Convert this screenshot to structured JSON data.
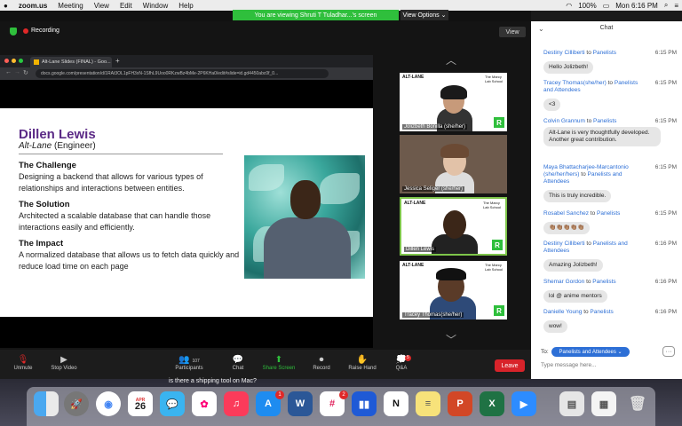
{
  "menubar": {
    "app": "zoom.us",
    "items": [
      "Meeting",
      "View",
      "Edit",
      "Window",
      "Help"
    ],
    "battery": "100%",
    "clock": "Mon 6:16 PM"
  },
  "banner": {
    "viewing": "You are viewing Shruti T Tuladhar...'s screen",
    "view_options": "View Options ⌄"
  },
  "recording": "Recording",
  "view_button": "View",
  "browser": {
    "tab": "Alt-Lane Slides (FINAL) - Goo...",
    "url": "docs.google.com/presentation/d/1RAt3OL1pFH3xN-1SfhL9Uoo0RKzwBz4bMe-2P6KHa0/edit#slide=id.gd4450abc0f_0..."
  },
  "slide": {
    "name": "Dillen Lewis",
    "company": "Alt-Lane",
    "role": "(Engineer)",
    "h1": "The Challenge",
    "b1": "Designing a backend that allows for various types of relationships and interactions between entities.",
    "h2": "The Solution",
    "b2": "Architected a scalable database that can handle those interactions easily and efficiently.",
    "h3": "The Impact",
    "b3": "A normalized database that allows us to fetch data quickly and reduce load time on each page"
  },
  "tiles": [
    {
      "name": "Jolizbeth Bonilla (she/her)",
      "logo": "ALT-LANE",
      "school": "The Marcy Lab School"
    },
    {
      "name": "Jessica Seliger (she/her)"
    },
    {
      "name": "Dillen Lewis",
      "logo": "ALT-LANE",
      "school": "The Marcy Lab School"
    },
    {
      "name": "Tracey Thomas(she/her)",
      "logo": "ALT-LANE",
      "school": "The Marcy Lab School"
    }
  ],
  "toolbar": {
    "unmute": "Unmute",
    "stop_video": "Stop Video",
    "participants": "Participants",
    "participants_count": "107",
    "chat": "Chat",
    "share": "Share Screen",
    "record": "Record",
    "raise": "Raise Hand",
    "qa": "Q&A",
    "qa_count": "5",
    "leave": "Leave"
  },
  "chat": {
    "title": "Chat",
    "messages": [
      {
        "from": "Destiny Cilliberti",
        "to": "Panelists",
        "time": "6:15 PM",
        "text": "Hello Jolizbeth!"
      },
      {
        "from": "Tracey Thomas(she/her)",
        "to": "Panelists and Attendees",
        "time": "6:15 PM",
        "text": "<3"
      },
      {
        "from": "Colvin Grannum",
        "to": "Panelists",
        "time": "6:15 PM",
        "text": "Alt-Lane is very thoughtfully developed. Another great contribution."
      },
      {
        "from": "Maya Bhattacharjee-Marcantonio (she/her/hers)",
        "to": "Panelists and Attendees",
        "time": "6:15 PM",
        "text": "This is truly incredible."
      },
      {
        "from": "Rosabel Sanchez",
        "to": "Panelists",
        "time": "6:15 PM",
        "text": "👏🏽👏🏽👏🏽👏🏽👏🏽"
      },
      {
        "from": "Destiny Cilliberti",
        "to": "Panelists and Attendees",
        "time": "6:16 PM",
        "text": "Amazing Jolizbeth!"
      },
      {
        "from": "Shemar Gordon",
        "to": "Panelists",
        "time": "6:16 PM",
        "text": "lol @ anime mentors"
      },
      {
        "from": "Danielle Young",
        "to": "Panelists",
        "time": "6:16 PM",
        "text": "wow!"
      }
    ],
    "to_label": "To:",
    "to_value": "Panelists and Attendees ⌄",
    "input_placeholder": "Type message here..."
  },
  "desktop": {
    "tooltip": "is there a shipping tool on Mac?"
  },
  "dock": {
    "calendar_month": "APR",
    "calendar_day": "26",
    "appstore_badge": "1",
    "slack_badge": "2"
  },
  "colors": {
    "zoom_green": "#2fbf3c",
    "leave_red": "#d8232a",
    "chat_blue": "#2d6fd6",
    "slide_title": "#5b2a86"
  }
}
